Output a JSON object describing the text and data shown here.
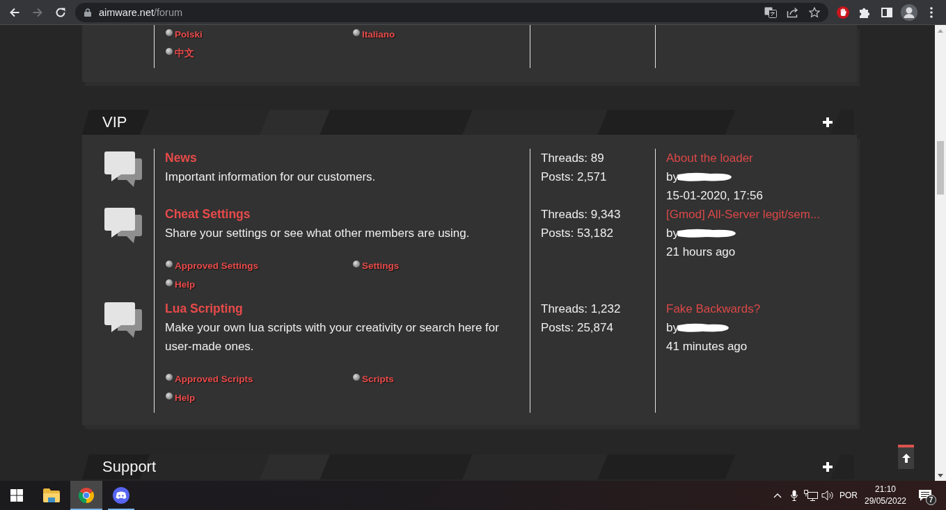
{
  "browser": {
    "nav": [
      {
        "kind": "back",
        "disabled": false
      },
      {
        "kind": "forward",
        "disabled": true
      },
      {
        "kind": "reload",
        "disabled": false
      }
    ],
    "url": {
      "host": "aimware.net",
      "path": "/forum"
    }
  },
  "top_panel": {
    "subforums": [
      "Polski",
      "Italiano",
      "中文"
    ]
  },
  "categories": [
    {
      "title": "VIP",
      "forums": [
        {
          "title": "News",
          "description": "Important information for our customers.",
          "threads": "Threads: 89",
          "posts": "Posts: 2,571",
          "last_post": {
            "title": "About the loader",
            "by": "by",
            "time": "15-01-2020, 17:56"
          }
        },
        {
          "title": "Cheat Settings",
          "description": "Share your settings or see what other members are using.",
          "threads": "Threads: 9,343",
          "posts": "Posts: 53,182",
          "last_post": {
            "title": "[Gmod] All-Server legit/sem...",
            "by": "by",
            "time": "21 hours ago"
          },
          "subforums": [
            "Approved Settings",
            "Settings",
            "Help"
          ]
        },
        {
          "title": "Lua Scripting",
          "description": "Make your own lua scripts with your creativity or search here for user-made ones.",
          "threads": "Threads: 1,232",
          "posts": "Posts: 25,874",
          "last_post": {
            "title": "Fake Backwards?",
            "by": "by",
            "time": "41 minutes ago"
          },
          "subforums": [
            "Approved Scripts",
            "Scripts",
            "Help"
          ]
        }
      ]
    },
    {
      "title": "Support"
    }
  ],
  "taskbar": {
    "apps": [
      {
        "kind": "files",
        "running": false,
        "selected": false
      },
      {
        "kind": "browser",
        "running": true,
        "selected": true
      },
      {
        "kind": "chat",
        "running": true,
        "selected": false
      }
    ],
    "language": "POR",
    "time": "21:10",
    "date": "29/05/2022",
    "notification_count": "7"
  }
}
